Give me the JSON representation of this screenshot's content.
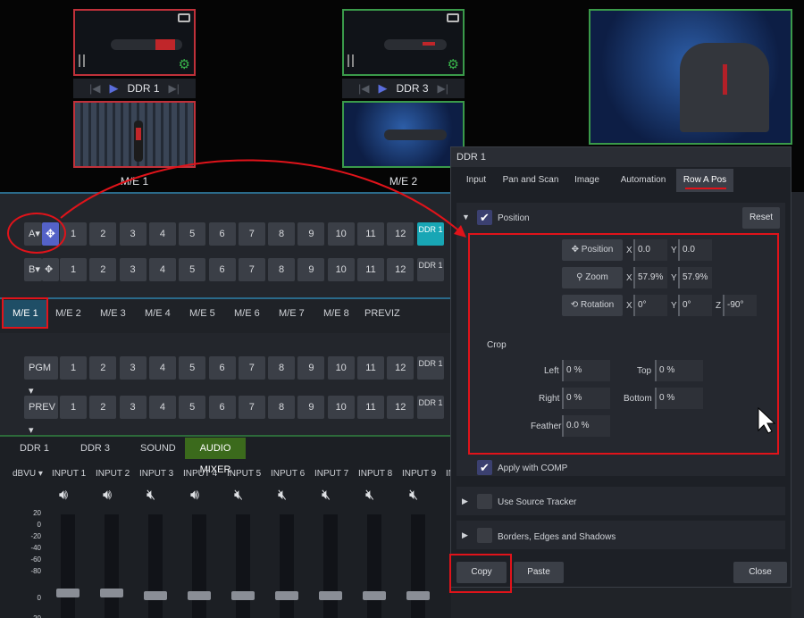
{
  "top": {
    "ddr1_label": "DDR 1",
    "ddr3_label": "DDR 3",
    "me1_label": "M/E 1",
    "me2_label": "M/E 2"
  },
  "rows": {
    "a_label": "A",
    "b_label": "B",
    "pgm_label": "PGM",
    "prev_label": "PREV",
    "numbers": [
      "1",
      "2",
      "3",
      "4",
      "5",
      "6",
      "7",
      "8",
      "9",
      "10",
      "11",
      "12"
    ],
    "ddr_btn": "DDR 1"
  },
  "me_tabs": [
    "M/E 1",
    "M/E 2",
    "M/E 3",
    "M/E 4",
    "M/E 5",
    "M/E 6",
    "M/E 7",
    "M/E 8",
    "PREVIZ"
  ],
  "mixer": {
    "tabs": [
      "DDR 1",
      "DDR 3",
      "SOUND",
      "AUDIO MIXER"
    ],
    "meter_label": "dBVU",
    "channels": [
      "INPUT 1",
      "INPUT 2",
      "INPUT 3",
      "INPUT 4",
      "INPUT 5",
      "INPUT 6",
      "INPUT 7",
      "INPUT 8",
      "INPUT 9",
      "IN"
    ],
    "scale": [
      "20",
      "0",
      "-20",
      "-40",
      "-60",
      "-80",
      "0",
      "-20"
    ]
  },
  "dialog": {
    "title": "DDR 1",
    "tabs": [
      "Input",
      "Pan and Scan",
      "Image",
      "Automation",
      "Row A Pos"
    ],
    "position_section": "Position",
    "reset": "Reset",
    "position_btn": "Position",
    "zoom_btn": "Zoom",
    "rotation_btn": "Rotation",
    "x": "X",
    "y": "Y",
    "z": "Z",
    "pos_x": "0.0",
    "pos_y": "0.0",
    "zoom_x": "57.9%",
    "zoom_y": "57.9%",
    "rot_x": "0°",
    "rot_y": "0°",
    "rot_z": "-90°",
    "crop": "Crop",
    "left": "Left",
    "top": "Top",
    "right": "Right",
    "bottom": "Bottom",
    "feather": "Feather",
    "left_v": "0 %",
    "top_v": "0 %",
    "right_v": "0 %",
    "bottom_v": "0 %",
    "feather_v": "0.0 %",
    "apply_comp": "Apply with COMP",
    "use_tracker": "Use Source Tracker",
    "borders": "Borders, Edges and Shadows",
    "copy": "Copy",
    "paste": "Paste",
    "close": "Close"
  },
  "colors": {
    "accent": "#18a6b5",
    "select": "#5462c8",
    "annotation": "#e0131a",
    "audio_tab": "#3b6a1c"
  }
}
